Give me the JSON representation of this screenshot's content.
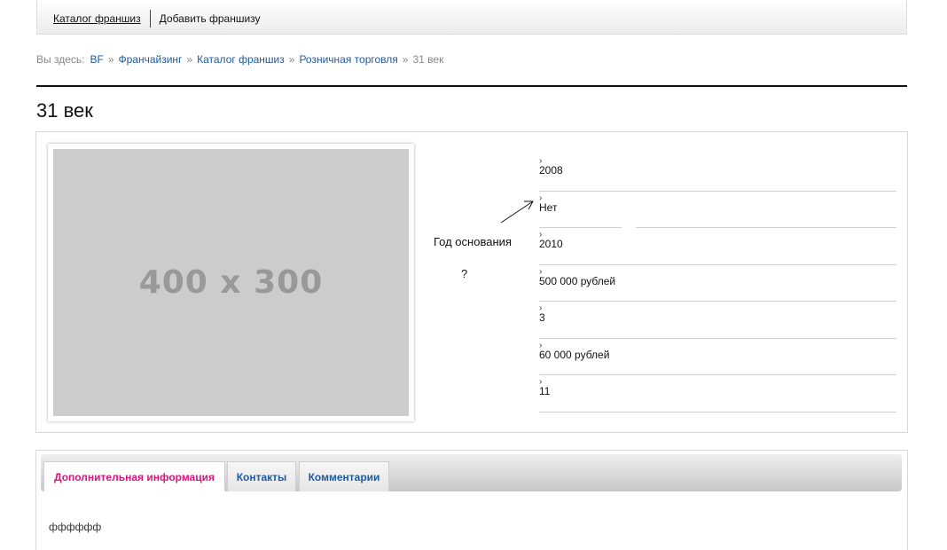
{
  "topnav": {
    "items": [
      {
        "label": "Каталог франшиз",
        "active": true
      },
      {
        "label": "Добавить франшизу",
        "active": false
      }
    ]
  },
  "breadcrumb": {
    "prefix": "Вы здесь:",
    "links": [
      "BF",
      "Франчайзинг",
      "Каталог франшиз",
      "Розничная торговля"
    ],
    "separator": "»",
    "current": "31 век"
  },
  "page": {
    "title": "31 век"
  },
  "photo": {
    "placeholder": "400 x 300"
  },
  "details": {
    "label": "Год основания",
    "question": "?",
    "values": [
      "2008",
      "Нет",
      "2010",
      "500 000 рублей",
      "3",
      "60 000 рублей",
      "11"
    ]
  },
  "tabs": {
    "items": [
      {
        "label": "Дополнительная информация",
        "active": true
      },
      {
        "label": "Контакты",
        "active": false
      },
      {
        "label": "Комментарии",
        "active": false
      }
    ],
    "content": "фффффф"
  },
  "colors": {
    "link": "#1e5a9c",
    "active_tab": "#d6157d",
    "placeholder_bg": "#cccccc"
  }
}
